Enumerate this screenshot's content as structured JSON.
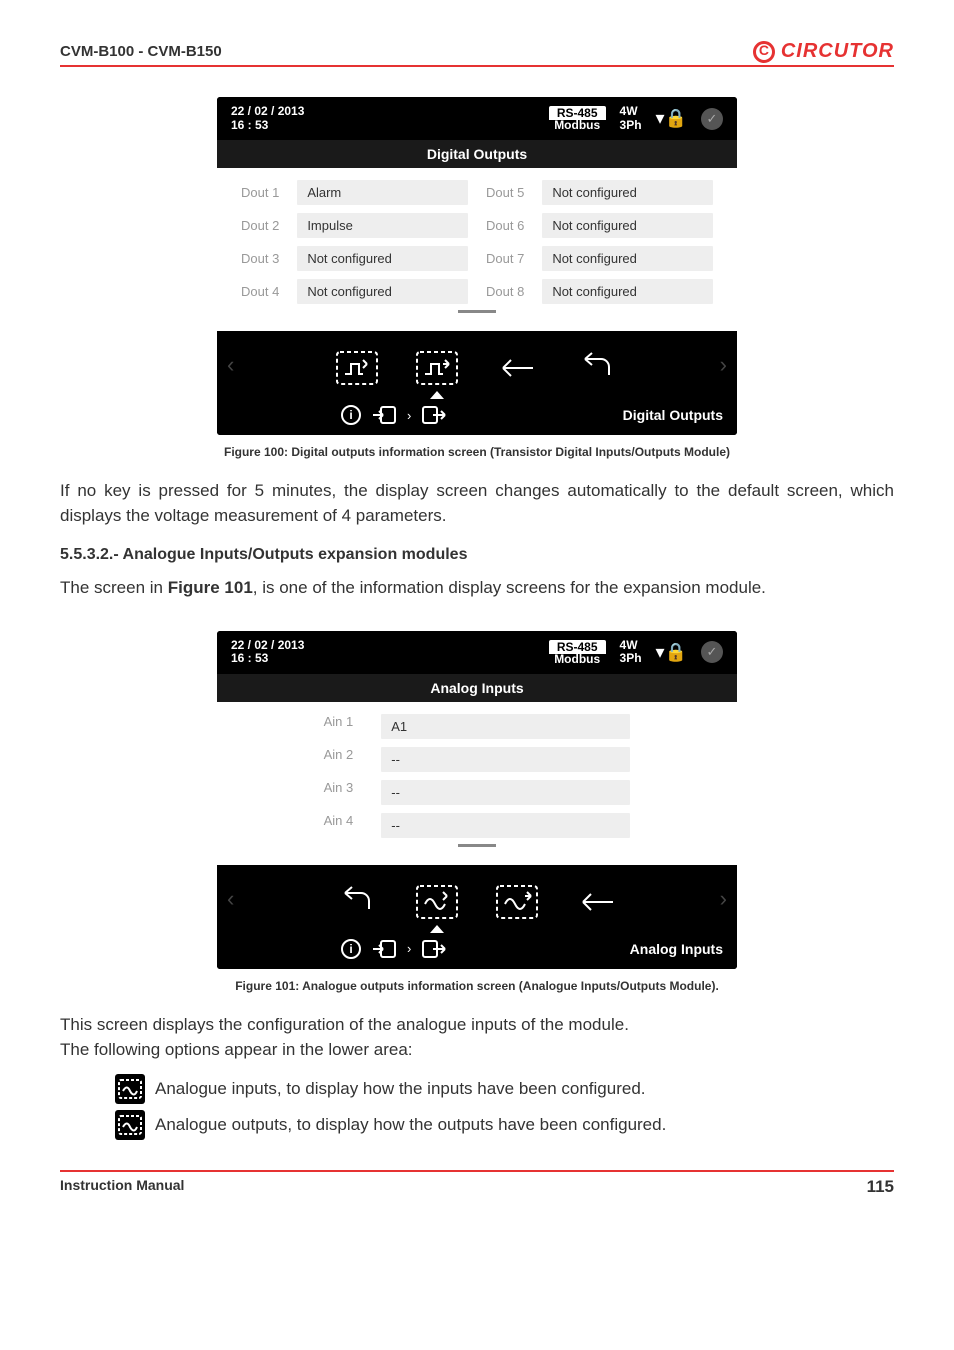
{
  "header": {
    "title": "CVM-B100 - CVM-B150",
    "brand": "CIRCUTOR"
  },
  "datetime": {
    "date": "22 / 02 / 2013",
    "time": "16 : 53"
  },
  "status": {
    "proto_top": "RS-485",
    "proto_bot": "Modbus",
    "wire_top": "4W",
    "wire_bot": "3Ph"
  },
  "fig100": {
    "header": "Digital Outputs",
    "rows": [
      {
        "l1": "Dout 1",
        "v1": "Alarm",
        "l2": "Dout 5",
        "v2": "Not configured"
      },
      {
        "l1": "Dout 2",
        "v1": "Impulse",
        "l2": "Dout 6",
        "v2": "Not configured"
      },
      {
        "l1": "Dout 3",
        "v1": "Not configured",
        "l2": "Dout 7",
        "v2": "Not configured"
      },
      {
        "l1": "Dout 4",
        "v1": "Not configured",
        "l2": "Dout 8",
        "v2": "Not configured"
      }
    ],
    "footer": "Digital Outputs",
    "caption": "Figure 100: Digital outputs information screen (Transistor Digital Inputs/Outputs Module)"
  },
  "para1": "If no key is pressed for 5 minutes, the display screen changes automatically to the default screen, which displays the voltage measurement of 4 parameters.",
  "section": "5.5.3.2.- Analogue Inputs/Outputs expansion modules",
  "para2a": "The screen in ",
  "para2b": "Figure 101",
  "para2c": ", is one of the information display screens for the expansion module.",
  "fig101": {
    "header": "Analog Inputs",
    "rows": [
      {
        "l": "Ain 1",
        "v": "A1"
      },
      {
        "l": "Ain 2",
        "v": "--"
      },
      {
        "l": "Ain 3",
        "v": "--"
      },
      {
        "l": "Ain 4",
        "v": "--"
      }
    ],
    "footer": "Analog Inputs",
    "caption": "Figure 101: Analogue outputs information screen (Analogue Inputs/Outputs Module)."
  },
  "para3": "This screen displays the configuration of the analogue inputs of the module.",
  "para4": "The following options appear in the lower area:",
  "opt1": " Analogue inputs, to display how the inputs have been configured.",
  "opt2": " Analogue outputs, to display how the outputs have been configured.",
  "footer": {
    "label": "Instruction Manual",
    "page": "115"
  }
}
